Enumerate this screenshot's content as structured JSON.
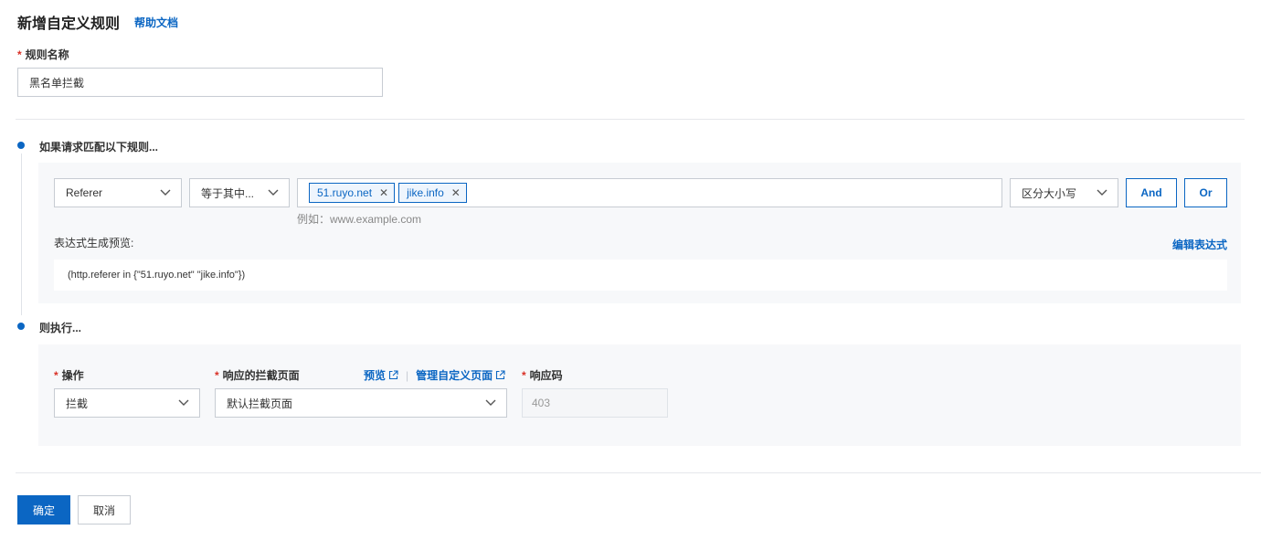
{
  "header": {
    "title": "新增自定义规则",
    "help_link": "帮助文档"
  },
  "rule_name": {
    "label": "规则名称",
    "required_mark": "*",
    "value": "黑名单拦截"
  },
  "match_section": {
    "title": "如果请求匹配以下规则...",
    "field_select": "Referer",
    "operator_select": "等于其中...",
    "tags": [
      {
        "label": "51.ruyo.net"
      },
      {
        "label": "jike.info"
      }
    ],
    "input_hint": "例如：www.example.com",
    "case_select": "区分大小写",
    "and_button": "And",
    "or_button": "Or",
    "preview_label": "表达式生成预览:",
    "edit_expression_link": "编辑表达式",
    "expression": "(http.referer in {\"51.ruyo.net\" \"jike.info\"})"
  },
  "action_section": {
    "title": "则执行...",
    "operation": {
      "label": "操作",
      "required_mark": "*",
      "value": "拦截"
    },
    "block_page": {
      "label": "响应的拦截页面",
      "required_mark": "*",
      "value": "默认拦截页面",
      "preview_link": "预览",
      "manage_link": "管理自定义页面"
    },
    "response_code": {
      "label": "响应码",
      "required_mark": "*",
      "value": "403"
    }
  },
  "footer": {
    "confirm_button": "确定",
    "cancel_button": "取消"
  },
  "colors": {
    "accent": "#0b66c3",
    "required": "#d93026",
    "panel_bg": "#f7f8fa"
  },
  "icons": {
    "select_arrow": "chevron-down-icon",
    "tag_remove": "close-icon",
    "external_link": "external-link-icon"
  }
}
